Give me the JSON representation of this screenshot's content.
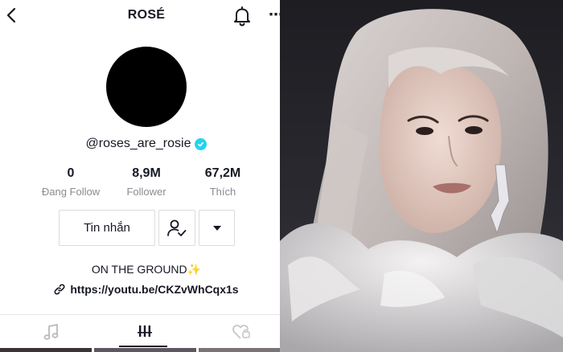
{
  "header": {
    "title": "ROSÉ",
    "more_label": "⋯"
  },
  "profile": {
    "username": "@roses_are_rosie",
    "bio": "ON THE GROUND✨",
    "link": "https://youtu.be/CKZvWhCqx1s"
  },
  "stats": [
    {
      "value": "0",
      "label": "Đang Follow"
    },
    {
      "value": "8,9M",
      "label": "Follower"
    },
    {
      "value": "67,2M",
      "label": "Thích"
    }
  ],
  "actions": {
    "message_label": "Tin nhắn"
  },
  "tabs": [
    {
      "icon": "music-note-icon",
      "active": false
    },
    {
      "icon": "grid-icon",
      "active": true
    },
    {
      "icon": "liked-heart-icon",
      "active": false
    }
  ],
  "colors": {
    "text": "#161823",
    "muted": "#8a8b91",
    "border": "#dcdce0",
    "verified": "#20d5ec"
  }
}
